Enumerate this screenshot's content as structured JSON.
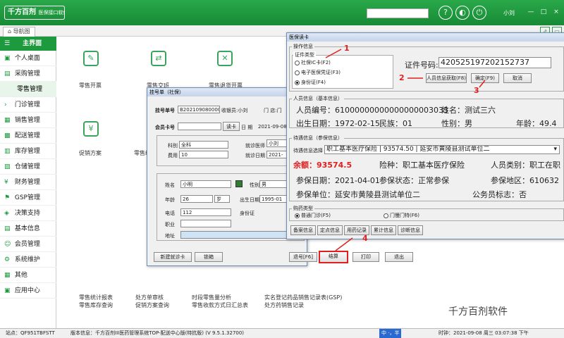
{
  "app": {
    "logo": "千方百剂",
    "subtitle": "医保接口软件",
    "user": "小刘",
    "controls": [
      "?",
      "◐",
      "⏻"
    ],
    "win_controls": [
      "—",
      "□",
      "×"
    ],
    "search_placeholder": ""
  },
  "tabs": {
    "home": "导航图"
  },
  "sidebar": {
    "header": "主界面",
    "items": [
      "个人桌面",
      "采购管理",
      "零售管理",
      "门诊管理",
      "销售管理",
      "配送管理",
      "库存管理",
      "仓储管理",
      "财务管理",
      "GSP管理",
      "决策支持",
      "基本信息",
      "会员管理",
      "系统维护",
      "其他",
      "应用中心"
    ]
  },
  "home": {
    "icons": [
      "零售开票",
      "零售交班",
      "零售退货开票",
      "零售收银",
      "促销方案",
      "零售统计"
    ],
    "links": [
      [
        "零售统计报表",
        "零售库存查询"
      ],
      [
        "处方单审核",
        "促销方案查询"
      ],
      [
        "时段零售量分析",
        "零售收款方式日汇总表"
      ],
      [
        "实名登记药品销售记录表(GSP)",
        "处方药销售记录"
      ]
    ]
  },
  "register": {
    "title": "挂号单（社保）",
    "reg_no_label": "挂号单号",
    "reg_no": "B20210908000006",
    "cashier_label": "收银员:小刘",
    "shop_label": "门 店:门",
    "member_label": "会员卡号",
    "read_card": "读卡",
    "date_label": "日 期",
    "date": "2021-09-08",
    "dept_label": "科别",
    "dept": "全科",
    "doctor_label": "就诊医师",
    "doctor": "小刘",
    "fee_label": "费用",
    "fee": "10",
    "visit_date_label": "就诊日期",
    "visit_date": "2021-",
    "name_label": "姓名",
    "name": "小明",
    "gender_label": "性别",
    "gender": "男",
    "age_label": "年龄",
    "age": "26",
    "age_unit": "岁",
    "birth_label": "出生日期",
    "birth": "1995-01",
    "phone_label": "电话",
    "phone": "112",
    "id_label": "身份证",
    "job_label": "职业",
    "addr_label": "地址",
    "btn_new_card": "新建就诊卡",
    "btn_lock": "锁箱",
    "btn_back": "退号[F6]",
    "btn_settle": "结算",
    "btn_print": "打印",
    "btn_exit": "退出"
  },
  "card": {
    "title": "医保读卡",
    "op_group": "操作信息",
    "cert_group": "证件类型",
    "cert_types": [
      "社保IC卡(F2)",
      "电子医保凭证(F3)",
      "身份证(F4)"
    ],
    "cert_no_label": "证件号码:",
    "cert_no": "420525197202152737",
    "btn_fetch": "人员信息获取(F8)",
    "btn_ok": "确定(F9)",
    "btn_cancel": "取消",
    "person_group": "人员信息（基本信息）",
    "person_no_label": "人员编号：",
    "person_no": "61000000000000000003033",
    "pname_label": "姓名：",
    "pname": "测试三六",
    "pbirth_label": "出生日期：",
    "pbirth": "1972-02-15",
    "nation_label": "民族：",
    "nation": "01",
    "psex_label": "性别：",
    "psex": "男",
    "page_label": "年龄：",
    "page": "49.4",
    "treat_group": "待遇信息（参保信息）",
    "treat_select_label": "待遇信息选择",
    "treat_select": "职工基本医疗保险 | 93574.50 | 延安市黄陵县测试单位二",
    "balance_label": "余额：",
    "balance": "93574.5",
    "insure_type_label": "险种：",
    "insure_type": "职工基本医疗保险",
    "ptype_label": "人员类别：",
    "ptype": "职工在职",
    "insure_date_label": "参保日期：",
    "insure_date": "2021-04-01",
    "insure_state_label": "参保状态：",
    "insure_state": "正常参保",
    "area_label": "参保地区：",
    "area": "610632",
    "unit_label": "参保单位：",
    "unit": "延安市黄陵县测试单位二",
    "civil_label": "公务员标志：",
    "civil": "否",
    "buy_group": "购药类型",
    "buy_types": [
      "普通门诊(F5)",
      "门慢门特(F6)"
    ],
    "bottom_btns": [
      "备案信息",
      "定点信息",
      "用药记录",
      "累计信息",
      "诊断信息"
    ]
  },
  "annotations": [
    "1",
    "2",
    "3",
    "4"
  ],
  "status": {
    "site": "站点：QF951TBFSTT",
    "version": "版本信息：千方百剂III医药管理系统TOP-配送中心版(特抗版) (V 9.5.1.32700)",
    "time": "时钟：2021-09-08 周三 03:07:38 下午",
    "ime": "中 ·，半"
  },
  "watermark": "千方百剂软件"
}
